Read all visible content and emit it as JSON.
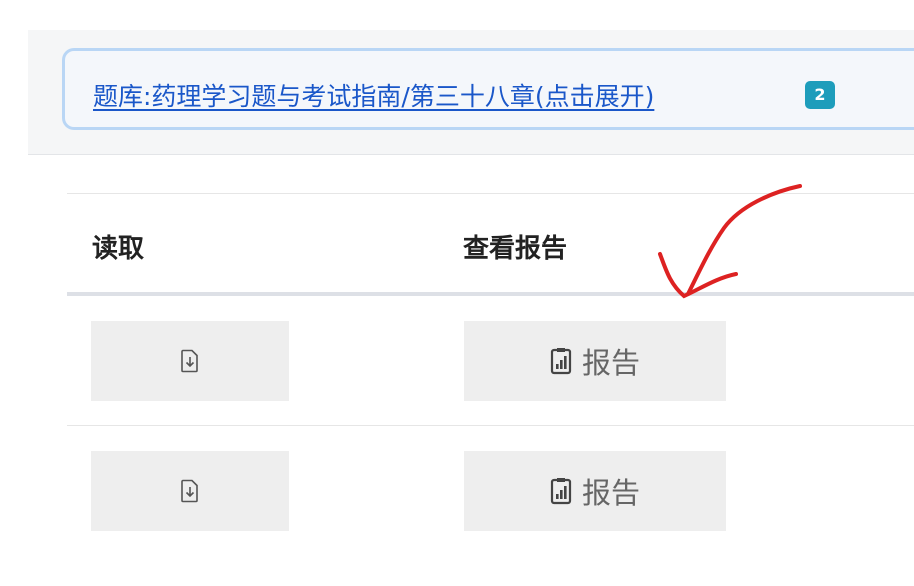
{
  "breadcrumb": {
    "link_text": "题库:药理学习题与考试指南/第三十八章(点击展开)",
    "count": "2"
  },
  "table": {
    "headers": [
      "读取",
      "查看报告"
    ],
    "rows": [
      {
        "read_icon": "file-download-icon",
        "report_icon": "file-chart-icon",
        "report_label": "报告"
      },
      {
        "read_icon": "file-download-icon",
        "report_icon": "file-chart-icon",
        "report_label": "报告"
      }
    ]
  },
  "colors": {
    "link": "#1a57c9",
    "badge": "#1e9dbb",
    "annotation_stroke": "#dd2222"
  }
}
